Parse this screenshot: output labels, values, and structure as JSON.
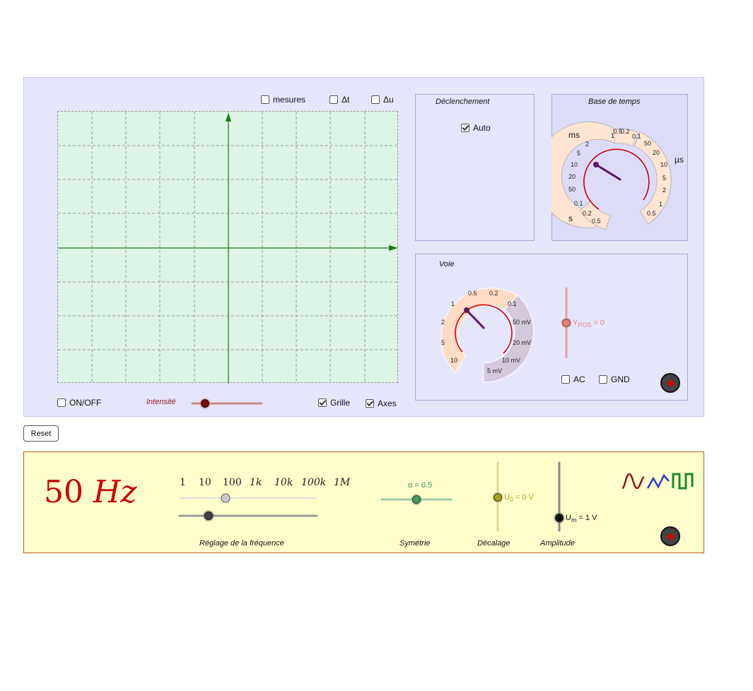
{
  "oscilloscope": {
    "measures": {
      "mesures": "mesures",
      "delta_t": "Δt",
      "delta_u": "Δu"
    },
    "bottom": {
      "on_off": "ON/OFF",
      "intensity": "Intensité",
      "grid": "Grille",
      "axes": "Axes"
    },
    "trigger": {
      "title": "Déclenchement",
      "auto": "Auto",
      "auto_checked": true
    },
    "timebase": {
      "title": "Base de temps",
      "unit_ms": "ms",
      "unit_us": "µs",
      "unit_s": "s",
      "ms_labels": [
        "1",
        "0.5",
        "0.2",
        "0.1",
        "2",
        "5",
        "10",
        "20",
        "50"
      ],
      "us_labels": [
        "50",
        "20",
        "10",
        "5",
        "2",
        "1",
        "0.5"
      ],
      "s_labels": [
        "0.1",
        "0.2",
        "0.5"
      ]
    },
    "channel": {
      "title": "Voie",
      "v_labels": [
        "0.5",
        "0.2",
        "0.1",
        "1",
        "2",
        "5",
        "10"
      ],
      "mv_labels": [
        "50 mV",
        "20 mV",
        "10 mV",
        "5 mV"
      ],
      "ypos_label": "Y",
      "ypos_sub": "POS",
      "ypos_value": "= 0",
      "ac": "AC",
      "gnd": "GND"
    },
    "reset": "Reset"
  },
  "generator": {
    "frequency_display": "50 Hz",
    "frequency_num": "50",
    "frequency_unit": "Hz",
    "freq_scale": [
      "1",
      "10",
      "100",
      "1k",
      "10k",
      "100k",
      "1M"
    ],
    "symmetry_label": "α = 0.5",
    "offset_label": "U",
    "offset_sub": "0",
    "offset_value": "= 0 V",
    "amplitude_label": "U",
    "amplitude_sub": "m",
    "amplitude_value": "= 1 V",
    "labels": {
      "frequency": "Réglage de la fréquence",
      "symmetry": "Symétrie",
      "offset": "Décalage",
      "amplitude": "Amplitude"
    }
  },
  "colors": {
    "scope_bg": "#e6e6fb",
    "screen_bg": "#ddf4e6",
    "axis": "#1a7a1a",
    "generator_bg": "#ffffcc",
    "frequency_text": "#cc0000"
  }
}
